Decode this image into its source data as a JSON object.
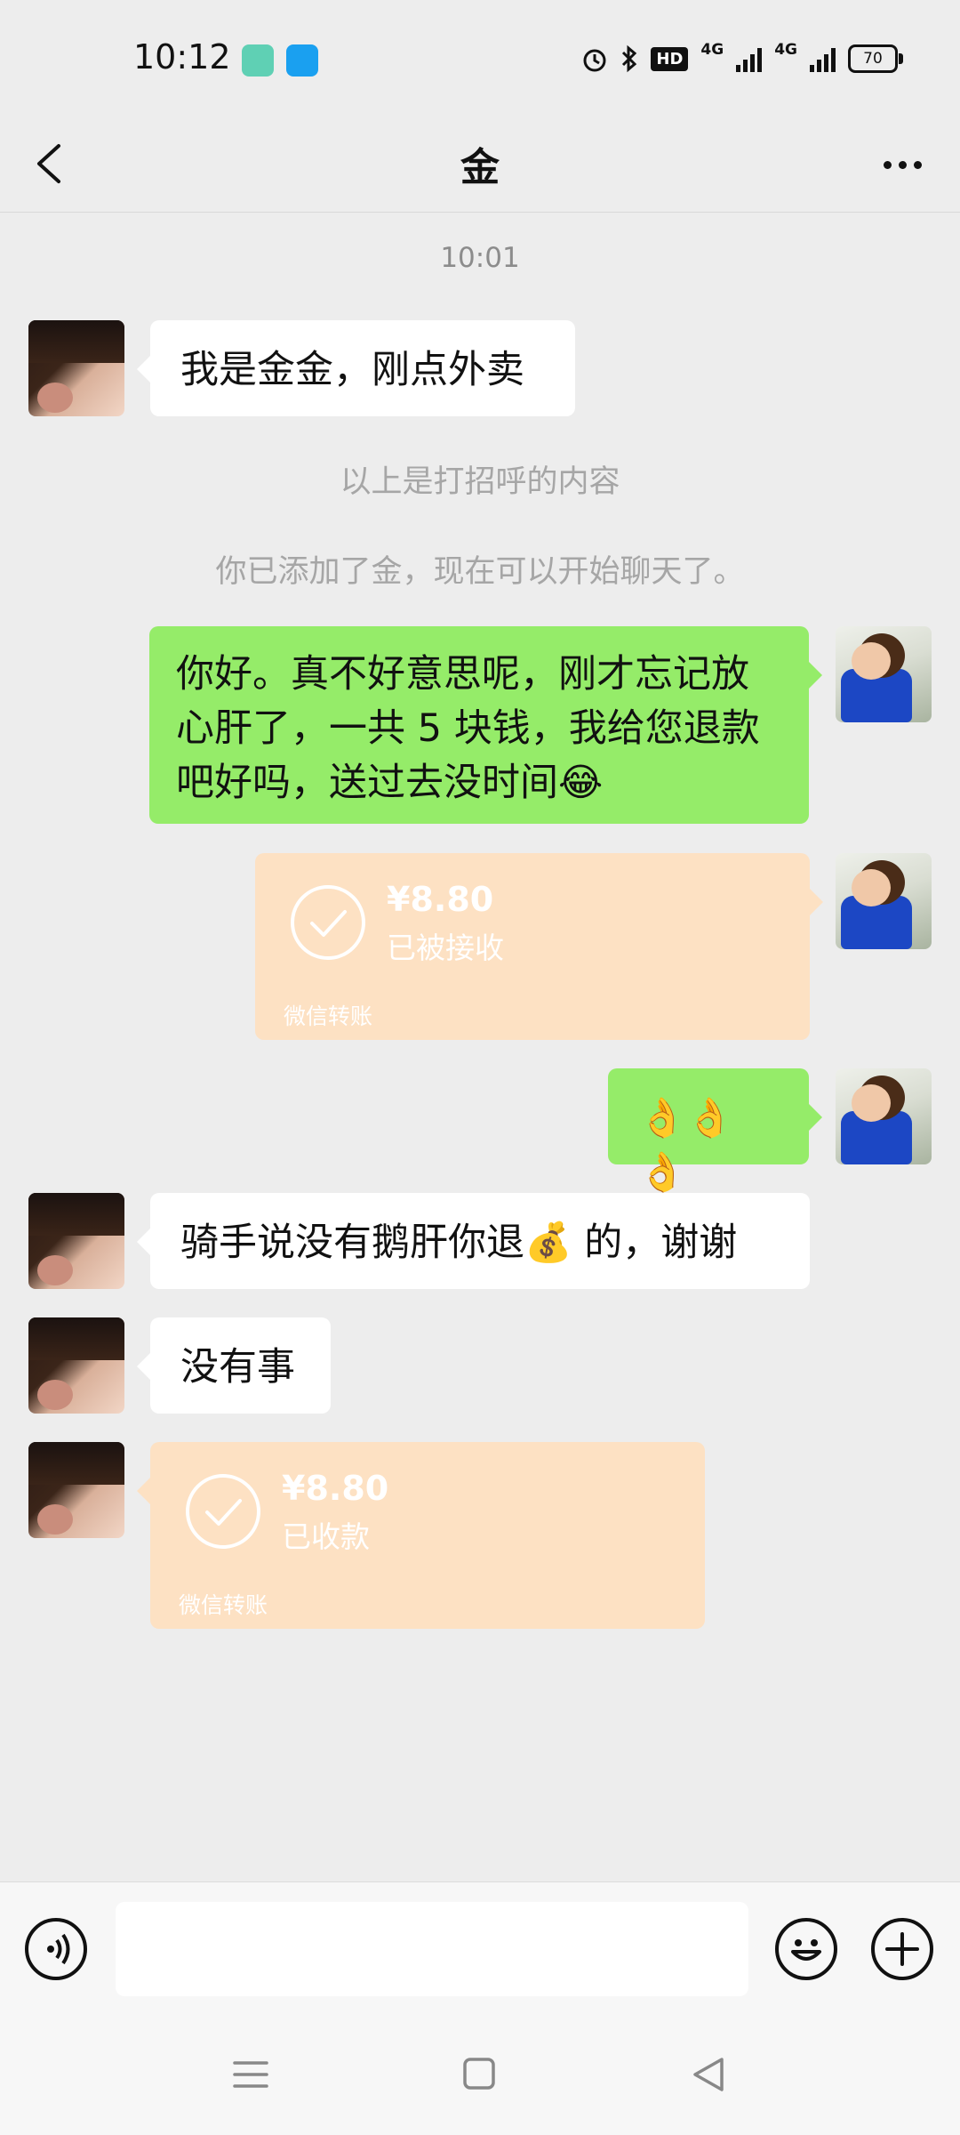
{
  "status_bar": {
    "time": "10:12",
    "hd_label": "HD",
    "network1": "4G",
    "network2": "4G",
    "battery": "70"
  },
  "header": {
    "title": "金"
  },
  "chat": {
    "timestamp": "10:01",
    "messages": [
      {
        "sender": "them",
        "text": "我是金金，刚点外卖"
      },
      {
        "sender": "system",
        "text": "以上是打招呼的内容"
      },
      {
        "sender": "system",
        "text": "你已添加了金，现在可以开始聊天了。"
      },
      {
        "sender": "me",
        "text": "你好。真不好意思呢，刚才忘记放心肝了，一共 5 块钱，我给您退款吧好吗，送过去没时间😂"
      },
      {
        "sender": "me",
        "type": "transfer",
        "amount": "¥8.80",
        "status": "已被接收",
        "source": "微信转账"
      },
      {
        "sender": "me",
        "text": "👌👌👌"
      },
      {
        "sender": "them",
        "text": "骑手说没有鹅肝你退💰 的，谢谢"
      },
      {
        "sender": "them",
        "text": "没有事"
      },
      {
        "sender": "them",
        "type": "transfer",
        "amount": "¥8.80",
        "status": "已收款",
        "source": "微信转账"
      }
    ]
  },
  "input_bar": {
    "value": "",
    "placeholder": ""
  },
  "colors": {
    "background": "#ededed",
    "outgoing_bubble": "#95ec69",
    "incoming_bubble": "#ffffff",
    "transfer_card": "#fde1c3"
  },
  "icons": [
    "back-arrow-icon",
    "more-dots-icon",
    "voice-icon",
    "emoji-icon",
    "plus-icon",
    "check-circle-icon",
    "menu-icon",
    "home-square-icon",
    "back-triangle-icon"
  ]
}
